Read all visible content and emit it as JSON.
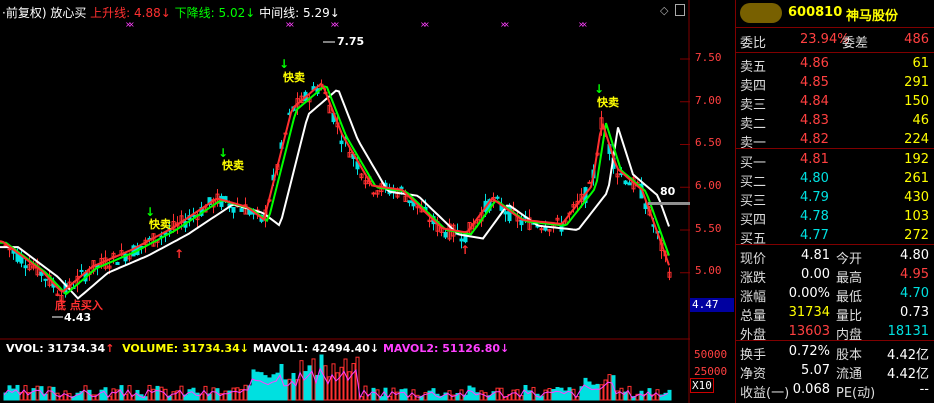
{
  "header": {
    "period_label": "·前复权)",
    "indicator_name": "放心买",
    "up_line_label": "上升线:",
    "up_line_value": "4.88",
    "down_line_label": "下降线:",
    "down_line_value": "5.02",
    "mid_line_label": "中间线:",
    "mid_line_value": "5.29"
  },
  "chart_annotations": {
    "high_label": "7.75",
    "low_label": "4.43",
    "current_mark": "4.47",
    "mid_marker": "80",
    "signals": [
      "快卖",
      "快卖",
      "快卖",
      "快卖",
      "底 点买入"
    ]
  },
  "price_axis": {
    "ticks": [
      "7.50",
      "7.00",
      "6.50",
      "6.00",
      "5.50",
      "5.00"
    ]
  },
  "volume_header": {
    "vvol_label": "VVOL:",
    "vvol_value": "31734.34",
    "volume_label": "VOLUME:",
    "volume_value": "31734.34",
    "mavol1_label": "MAVOL1:",
    "mavol1_value": "42494.40",
    "mavol2_label": "MAVOL2:",
    "mavol2_value": "51126.80"
  },
  "volume_axis": {
    "ticks": [
      "50000",
      "25000"
    ],
    "unit": "X10"
  },
  "stock": {
    "code": "600810",
    "name": "神马股份"
  },
  "ratio": {
    "label": "委比",
    "value": "23.94%",
    "diff_label": "委差",
    "diff_value": "486"
  },
  "asks": [
    {
      "label": "卖五",
      "price": "4.86",
      "volume": "61"
    },
    {
      "label": "卖四",
      "price": "4.85",
      "volume": "291"
    },
    {
      "label": "卖三",
      "price": "4.84",
      "volume": "150"
    },
    {
      "label": "卖二",
      "price": "4.83",
      "volume": "46"
    },
    {
      "label": "卖一",
      "price": "4.82",
      "volume": "224"
    }
  ],
  "bids": [
    {
      "label": "买一",
      "price": "4.81",
      "volume": "192"
    },
    {
      "label": "买二",
      "price": "4.80",
      "volume": "261"
    },
    {
      "label": "买三",
      "price": "4.79",
      "volume": "430"
    },
    {
      "label": "买四",
      "price": "4.78",
      "volume": "103"
    },
    {
      "label": "买五",
      "price": "4.77",
      "volume": "272"
    }
  ],
  "stats": [
    {
      "l1": "现价",
      "v1": "4.81",
      "l2": "今开",
      "v2": "4.80"
    },
    {
      "l1": "涨跌",
      "v1": "0.00",
      "l2": "最高",
      "v2": "4.95"
    },
    {
      "l1": "涨幅",
      "v1": "0.00%",
      "l2": "最低",
      "v2": "4.70"
    },
    {
      "l1": "总量",
      "v1": "31734",
      "l2": "量比",
      "v2": "0.73"
    },
    {
      "l1": "外盘",
      "v1": "13603",
      "l2": "内盘",
      "v2": "18131"
    }
  ],
  "fundamentals": [
    {
      "l1": "换手",
      "v1": "0.72%",
      "l2": "股本",
      "v2": "4.42亿"
    },
    {
      "l1": "净资",
      "v1": "5.07",
      "l2": "流通",
      "v2": "4.42亿"
    },
    {
      "l1": "收益(一)",
      "v1": "0.068",
      "l2": "PE(动)",
      "v2": "--"
    }
  ]
}
